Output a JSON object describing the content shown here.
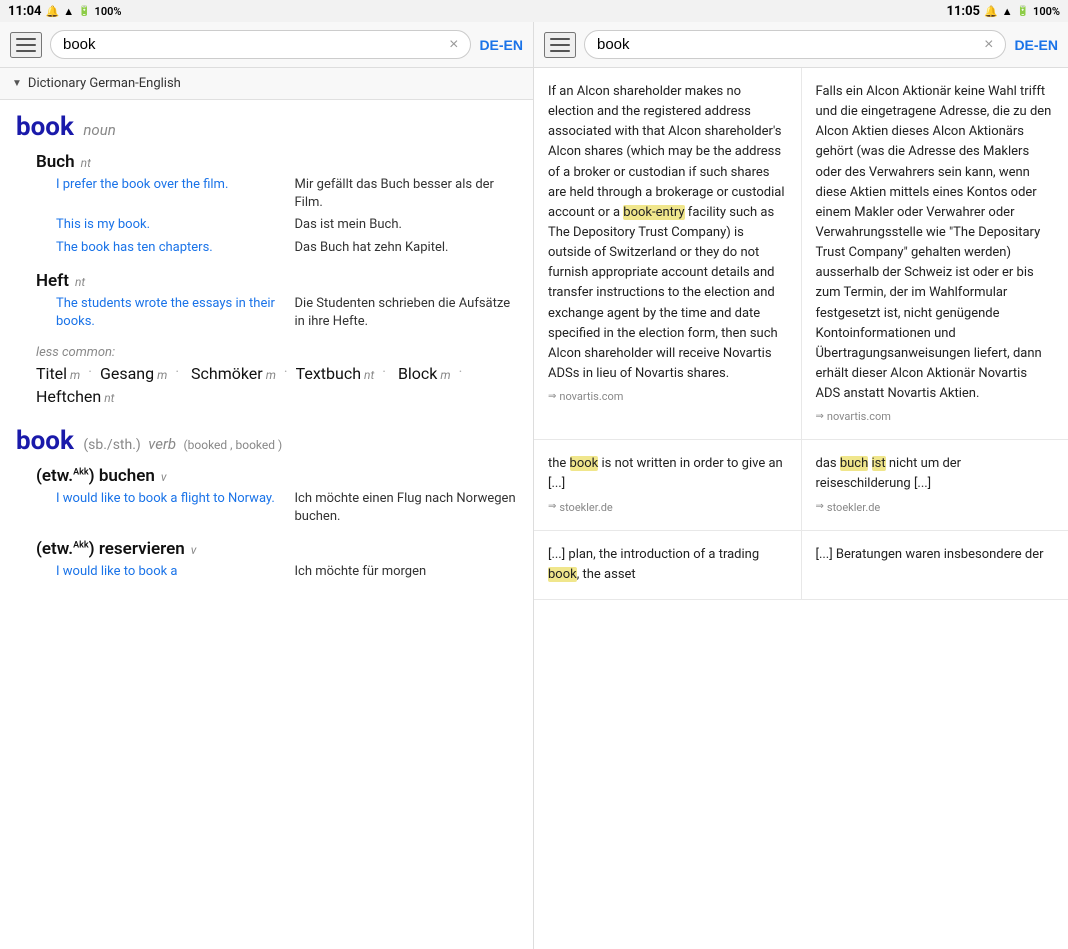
{
  "statusBar": {
    "left": {
      "time": "11:04",
      "battery": "100%"
    },
    "right": {
      "time": "11:05",
      "battery": "100%"
    }
  },
  "leftPanel": {
    "searchBar": {
      "query": "book",
      "clearLabel": "×",
      "langLabel": "DE-EN"
    },
    "dictHeader": "Dictionary German-English",
    "entries": [
      {
        "word": "book",
        "pos": "noun",
        "translations": [
          {
            "de": "Buch",
            "gender": "nt",
            "examples": [
              {
                "en": "I prefer the book over the film.",
                "de": "Mir gefällt das Buch besser als der Film."
              },
              {
                "en": "This is my book.",
                "de": "Das ist mein Buch."
              },
              {
                "en": "The book has ten chapters.",
                "de": "Das Buch hat zehn Kapitel."
              }
            ]
          },
          {
            "de": "Heft",
            "gender": "nt",
            "examples": [
              {
                "en": "The students wrote the essays in their books.",
                "de": "Die Studenten schrieben die Aufsätze in ihre Hefte."
              }
            ]
          }
        ],
        "lessCommon": {
          "label": "less common:",
          "items": [
            {
              "de": "Titel",
              "gender": "m"
            },
            {
              "de": "Gesang",
              "gender": "m"
            },
            {
              "de": "Schmöker",
              "gender": "m"
            },
            {
              "de": "Textbuch",
              "gender": "nt"
            },
            {
              "de": "Block",
              "gender": "m"
            },
            {
              "de": "Heftchen",
              "gender": "nt"
            }
          ]
        }
      },
      {
        "word": "book",
        "posLabel": "(sb./sth.)",
        "pos": "verb",
        "forms": "(booked , booked )",
        "translations": [
          {
            "de": "(etw.Akk) buchen",
            "genderAbbr": "v",
            "examples": [
              {
                "en": "I would like to book a flight to Norway.",
                "de": "Ich möchte einen Flug nach Norwegen buchen."
              }
            ]
          },
          {
            "de": "(etw.Akk) reservieren",
            "genderAbbr": "v",
            "examples": [
              {
                "en": "I would like to book a",
                "de": "Ich möchte für morgen"
              }
            ]
          }
        ]
      }
    ]
  },
  "rightPanel": {
    "searchBar": {
      "query": "book",
      "clearLabel": "×",
      "langLabel": "DE-EN"
    },
    "corpusEntries": [
      {
        "en": "If an Alcon shareholder makes no election and the registered address associated with that Alcon shareholder's Alcon shares (which may be the address of a broker or custodian if such shares are held through a brokerage or custodial account or a book-entry facility such as The Depository Trust Company) is outside of Switzerland or they do not furnish appropriate account details and transfer instructions to the election and exchange agent by the time and date specified in the election form, then such Alcon shareholder will receive Novartis ADSs in lieu of Novartis shares.",
        "de": "Falls ein Alcon Aktionär keine Wahl trifft und die eingetragene Adresse, die zu den Alcon Aktien dieses Alcon Aktionärs gehört (was die Adresse des Maklers oder des Verwahrers sein kann, wenn diese Aktien mittels eines Kontos oder einem Makler oder Verwahrer oder Verwahrungsstelle wie \"The Depositary Trust Company\" gehalten werden) ausserhalb der Schweiz ist oder er bis zum Termin, der im Wahlformular festgesetzt ist, nicht genügende Kontoinformationen und Übertragungsanweisungen liefert, dann erhält dieser Alcon Aktionär Novartis ADS anstatt Novartis Aktien.",
        "source": "novartis.com",
        "highlightWords": [
          "book-entry"
        ],
        "highlightWordsDE": []
      },
      {
        "en": "the book is not written in order to give an [...]",
        "de": "das buch ist nicht um der reiseschilderung [...]",
        "source": "stoekler.de",
        "highlightEn": "book",
        "highlightDE": [
          "buch",
          "ist"
        ]
      },
      {
        "en": "[...] plan, the introduction of a trading book, the asset",
        "de": "[...] Beratungen waren insbesondere der",
        "source": "",
        "highlightEn": "book",
        "highlightDE": []
      }
    ]
  }
}
